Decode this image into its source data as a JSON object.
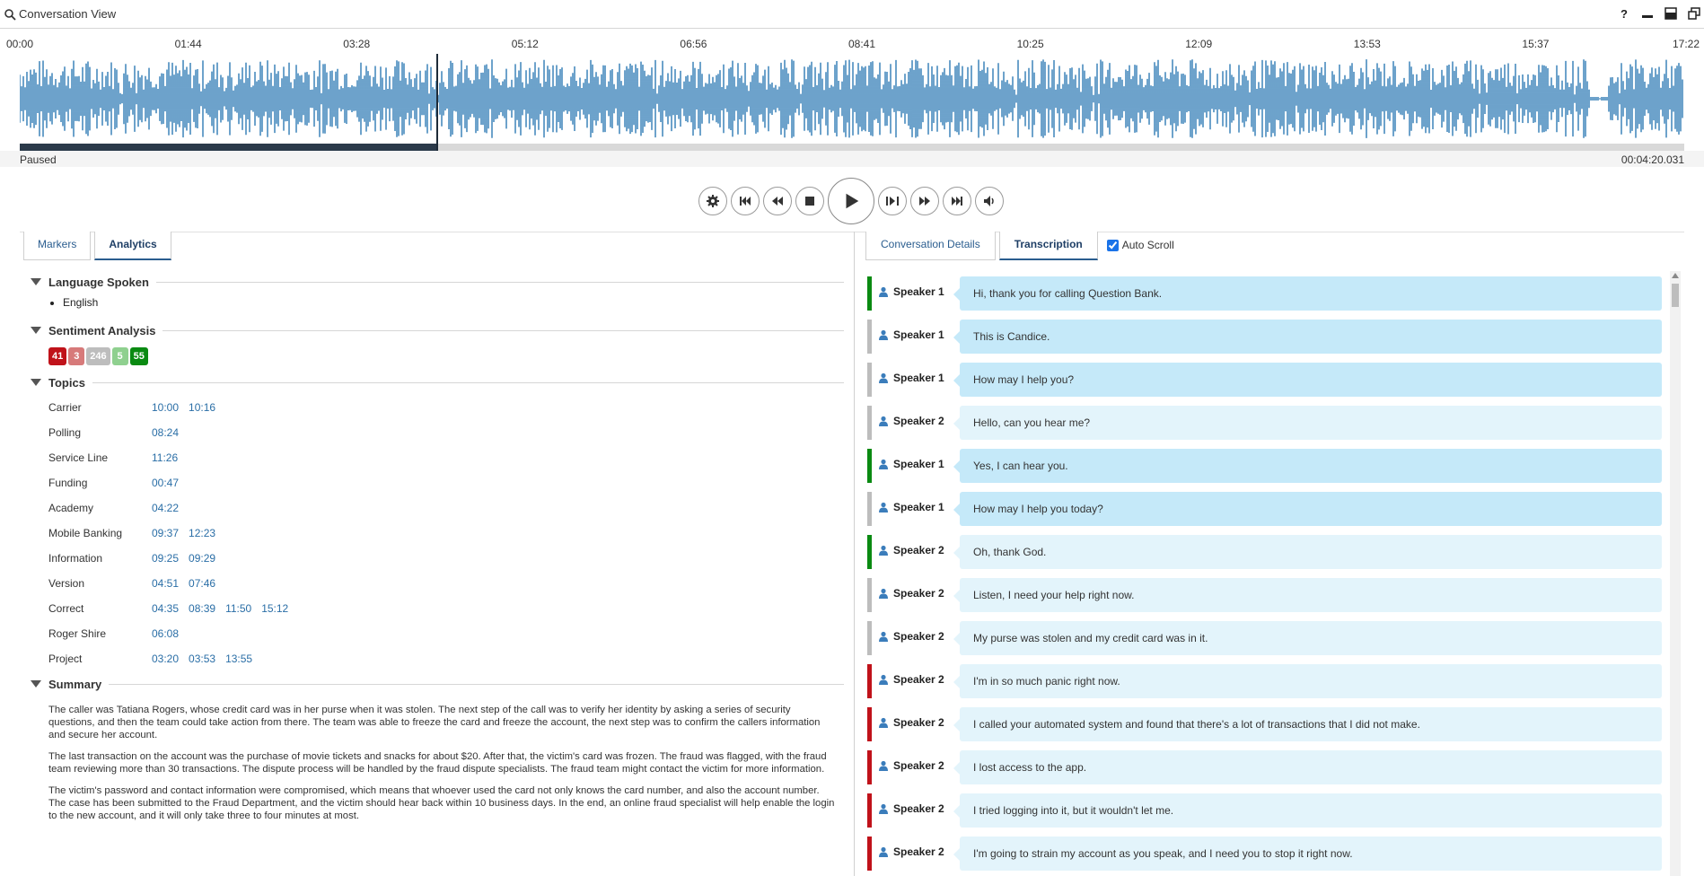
{
  "window": {
    "title": "Conversation View",
    "icons": [
      "help-icon",
      "minimize-icon",
      "maximize-icon",
      "restore-icon"
    ]
  },
  "timeline": {
    "ticks": [
      "00:00",
      "01:44",
      "03:28",
      "05:12",
      "06:56",
      "08:41",
      "10:25",
      "12:09",
      "13:53",
      "15:37",
      "17:22"
    ]
  },
  "player": {
    "status": "Paused",
    "position": "00:04:20.031",
    "progress_fraction": 0.25,
    "controls": [
      "settings",
      "skip-to-start",
      "rewind",
      "stop",
      "play",
      "step",
      "fast-forward",
      "skip-to-end",
      "volume"
    ]
  },
  "left_tabs": {
    "markers": "Markers",
    "analytics": "Analytics"
  },
  "right_tabs": {
    "details": "Conversation Details",
    "transcription": "Transcription",
    "auto_scroll": "Auto Scroll"
  },
  "language": {
    "heading": "Language Spoken",
    "items": [
      "English"
    ]
  },
  "sentiment": {
    "heading": "Sentiment Analysis",
    "badges": [
      {
        "value": "41",
        "color": "#c0121a"
      },
      {
        "value": "3",
        "color": "#d77a7a"
      },
      {
        "value": "246",
        "color": "#bdbdbd"
      },
      {
        "value": "5",
        "color": "#8fd08f"
      },
      {
        "value": "55",
        "color": "#0a8a12"
      }
    ]
  },
  "topics": {
    "heading": "Topics",
    "items": [
      {
        "name": "Carrier",
        "times": [
          "10:00",
          "10:16"
        ]
      },
      {
        "name": "Polling",
        "times": [
          "08:24"
        ]
      },
      {
        "name": "Service Line",
        "times": [
          "11:26"
        ]
      },
      {
        "name": "Funding",
        "times": [
          "00:47"
        ]
      },
      {
        "name": "Academy",
        "times": [
          "04:22"
        ]
      },
      {
        "name": "Mobile Banking",
        "times": [
          "09:37",
          "12:23"
        ]
      },
      {
        "name": "Information",
        "times": [
          "09:25",
          "09:29"
        ]
      },
      {
        "name": "Version",
        "times": [
          "04:51",
          "07:46"
        ]
      },
      {
        "name": "Correct",
        "times": [
          "04:35",
          "08:39",
          "11:50",
          "15:12"
        ]
      },
      {
        "name": "Roger Shire",
        "times": [
          "06:08"
        ]
      },
      {
        "name": "Project",
        "times": [
          "03:20",
          "03:53",
          "13:55"
        ]
      }
    ]
  },
  "summary": {
    "heading": "Summary",
    "paragraphs": [
      "The caller was Tatiana Rogers, whose credit card was in her purse when it was stolen. The next step of the call was to verify her identity by asking a series of security questions, and then the team could take action from there. The team was able to freeze the card and freeze the account, the next step was to confirm the callers information and secure her account.",
      "The last transaction on the account was the purchase of movie tickets and snacks for about $20. After that, the victim's card was frozen. The fraud was flagged, with the fraud team reviewing more than 30 transactions. The dispute process will be handled by the fraud dispute specialists. The fraud team might contact the victim for more information.",
      "The victim's password and contact information were compromised, which means that whoever used the card not only knows the card number, and also the account number. The case has been submitted to the Fraud Department, and the victim should hear back within 10 business days. In the end, an online fraud specialist will help enable the login to the new account, and it will only take three to four minutes at most."
    ]
  },
  "transcript": [
    {
      "speaker": "Speaker 1",
      "text": "Hi, thank you for calling Question Bank.",
      "sentiment_color": "#0a8a12"
    },
    {
      "speaker": "Speaker 1",
      "text": "This is Candice.",
      "sentiment_color": "#bdbdbd"
    },
    {
      "speaker": "Speaker 1",
      "text": "How may I help you?",
      "sentiment_color": "#bdbdbd"
    },
    {
      "speaker": "Speaker 2",
      "text": "Hello, can you hear me?",
      "sentiment_color": "#bdbdbd"
    },
    {
      "speaker": "Speaker 1",
      "text": "Yes, I can hear you.",
      "sentiment_color": "#0a8a12"
    },
    {
      "speaker": "Speaker 1",
      "text": "How may I help you today?",
      "sentiment_color": "#bdbdbd"
    },
    {
      "speaker": "Speaker 2",
      "text": "Oh, thank God.",
      "sentiment_color": "#0a8a12"
    },
    {
      "speaker": "Speaker 2",
      "text": "Listen, I need your help right now.",
      "sentiment_color": "#bdbdbd"
    },
    {
      "speaker": "Speaker 2",
      "text": "My purse was stolen and my credit card was in it.",
      "sentiment_color": "#bdbdbd"
    },
    {
      "speaker": "Speaker 2",
      "text": "I'm in so much panic right now.",
      "sentiment_color": "#c0121a"
    },
    {
      "speaker": "Speaker 2",
      "text": "I called your automated system and found that there's a lot of transactions that I did not make.",
      "sentiment_color": "#c0121a"
    },
    {
      "speaker": "Speaker 2",
      "text": "I lost access to the app.",
      "sentiment_color": "#c0121a"
    },
    {
      "speaker": "Speaker 2",
      "text": "I tried logging into it, but it wouldn't let me.",
      "sentiment_color": "#c0121a"
    },
    {
      "speaker": "Speaker 2",
      "text": "I'm going to strain my account as you speak, and I need you to stop it right now.",
      "sentiment_color": "#c0121a"
    }
  ]
}
